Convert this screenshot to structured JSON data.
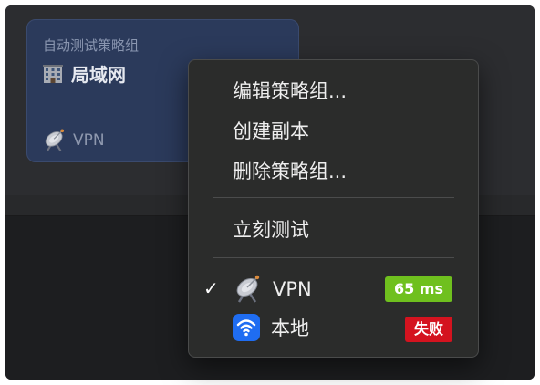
{
  "card": {
    "subtitle": "自动测试策略组",
    "title": "局域网",
    "proxy_label": "VPN",
    "title_icon": "building-icon",
    "proxy_icon": "satellite-antenna-icon"
  },
  "menu": {
    "edit_label": "编辑策略组...",
    "duplicate_label": "创建副本",
    "delete_label": "删除策略组...",
    "test_label": "立刻测试",
    "check_mark": "✓",
    "proxies": [
      {
        "name": "VPN",
        "icon": "satellite-antenna-icon",
        "status": "65 ms",
        "status_color": "#6fc01e",
        "selected": true
      },
      {
        "name": "本地",
        "icon": "wifi-icon",
        "status": "失败",
        "status_color": "#d4131f",
        "selected": false
      }
    ]
  },
  "colors": {
    "card_bg": "#2b3a5b",
    "menu_bg": "#2b2c2b",
    "wifi_bg": "#1f6df2"
  }
}
